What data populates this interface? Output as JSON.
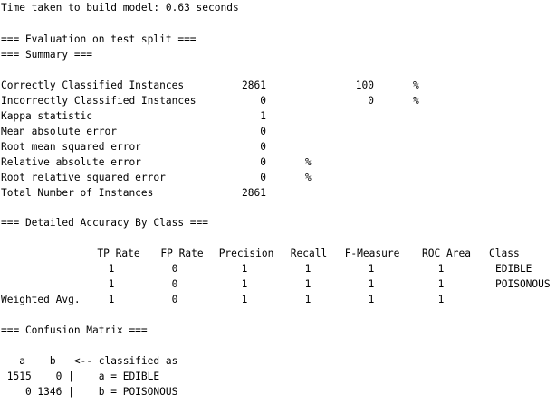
{
  "build_time": "Time taken to build model: 0.63 seconds",
  "eval_header": "=== Evaluation on test split ===",
  "summary_header": "=== Summary ===",
  "summary": [
    {
      "label": "Correctly Classified Instances",
      "value": "2861",
      "pct": "100",
      "pct_sign": "%"
    },
    {
      "label": "Incorrectly Classified Instances",
      "value": "0",
      "pct": "0",
      "pct_sign": "%"
    },
    {
      "label": "Kappa statistic",
      "value": "1"
    },
    {
      "label": "Mean absolute error",
      "value": "0"
    },
    {
      "label": "Root mean squared error",
      "value": "0"
    },
    {
      "label": "Relative absolute error",
      "value": "0",
      "unit": "%"
    },
    {
      "label": "Root relative squared error",
      "value": "0",
      "unit": "%"
    },
    {
      "label": "Total Number of Instances",
      "value": "2861"
    }
  ],
  "accuracy_header": "=== Detailed Accuracy By Class ===",
  "accuracy_columns": [
    "TP Rate",
    "FP Rate",
    "Precision",
    "Recall",
    "F-Measure",
    "ROC Area",
    "Class"
  ],
  "accuracy_rows": [
    {
      "label": "",
      "values": [
        "1",
        "0",
        "1",
        "1",
        "1",
        "1",
        "EDIBLE"
      ]
    },
    {
      "label": "",
      "values": [
        "1",
        "0",
        "1",
        "1",
        "1",
        "1",
        "POISONOUS"
      ]
    },
    {
      "label": "Weighted Avg.",
      "values": [
        "1",
        "0",
        "1",
        "1",
        "1",
        "1",
        ""
      ]
    }
  ],
  "confusion_header": "=== Confusion Matrix ===",
  "confusion_heading": "   a    b   <-- classified as",
  "confusion_rows": [
    " 1515    0 |    a = EDIBLE",
    "    0 1346 |    b = POISONOUS"
  ]
}
